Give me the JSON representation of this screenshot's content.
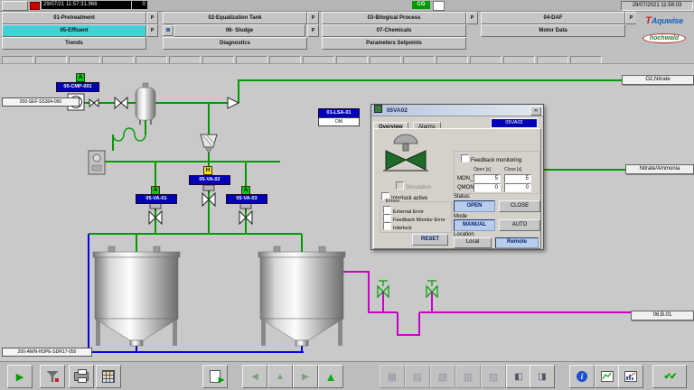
{
  "topbar": {
    "datetime_left": "29/07/21 11:57:31.966",
    "counter": "0",
    "cg_label": "CG",
    "datetime_right": "29/07/2021 11:58:03"
  },
  "nav": {
    "p_label": "P",
    "items": [
      {
        "label": "01-Pretreatment"
      },
      {
        "label": "02-Equalization Tank"
      },
      {
        "label": "03-Bilogical Process"
      },
      {
        "label": "04-DAF"
      },
      {
        "label": "05-Effluent"
      },
      {
        "label": "06- Sludge"
      },
      {
        "label": "07-Chemicals"
      },
      {
        "label": "Motor Data"
      },
      {
        "label": "Trends"
      },
      {
        "label": "Diagnostics"
      },
      {
        "label": "Parameters Setpoints"
      }
    ]
  },
  "logo": {
    "mark": "T",
    "top": "Aquwise",
    "bottom": "hochwald"
  },
  "diagram": {
    "labels": {
      "inlet": "200-SEF-SS304-050",
      "outlet_bottom": "200-AWN-HDPE-SDR17-050",
      "right_top": "O2,Nitrate",
      "right_mid": "Nitrate/Ammonia",
      "right_bottom": "06.B.01"
    },
    "tags": {
      "compressor": {
        "status": "A",
        "label": "05-CMP-001"
      },
      "level_switch": {
        "label": "01-LSA-01",
        "sub": "DM"
      },
      "valve_02": {
        "status": "H",
        "label": "05-VA-02"
      },
      "valve_01": {
        "status": "A",
        "label": "05-VA-01"
      },
      "valve_03": {
        "status": "A",
        "label": "05-VA-03"
      }
    }
  },
  "dialog": {
    "title": "05VA02",
    "tabs": [
      "Overview",
      "Alarms"
    ],
    "tag_badge": "05VA02",
    "simulation_label": "Simulation",
    "interlock_active_label": "Interlock active",
    "errors": {
      "title": "Errors",
      "items": [
        "External Error",
        "Feedback Monitor Error",
        "Interlock"
      ]
    },
    "reset_label": "RESET",
    "feedback_monitoring_label": "Feedback monitoring",
    "open_s_header": "Open [s]",
    "close_s_header": "Close [s]",
    "mon_t_label": "MON_T",
    "qmon_t_label": "QMON_T",
    "mon_t_open": "5",
    "mon_t_close": "5",
    "qmon_t_open": "0",
    "qmon_t_close": "0",
    "status_label": "Status:",
    "open_button": "OPEN",
    "close_button": "CLOSE",
    "mode_label": "Mode",
    "manual_button": "MANUAL",
    "auto_button": "AUTO",
    "location_label": "Location",
    "local_button": "Local",
    "remote_button": "Remote"
  },
  "toolbar": {
    "icons": [
      "play",
      "filter",
      "print",
      "report",
      "export",
      "nav-back",
      "nav-up",
      "nav-forward",
      "page-up",
      "tool-1",
      "tool-2",
      "tool-3",
      "tool-4",
      "tool-5",
      "window-1",
      "window-2",
      "info",
      "trend",
      "chart",
      "acknowledge"
    ]
  },
  "colors": {
    "accent_cyan": "#45d0d8",
    "tag_blue": "#0000b8",
    "badge_green": "#00cc00",
    "badge_yellow": "#ffe100",
    "pipe_green": "#009a00",
    "pipe_blue": "#0000e0",
    "pipe_magenta": "#c800c8",
    "cg_green": "#009a00",
    "selected_blue": "#b8ccec",
    "titlebar": "#b8c6dc"
  }
}
